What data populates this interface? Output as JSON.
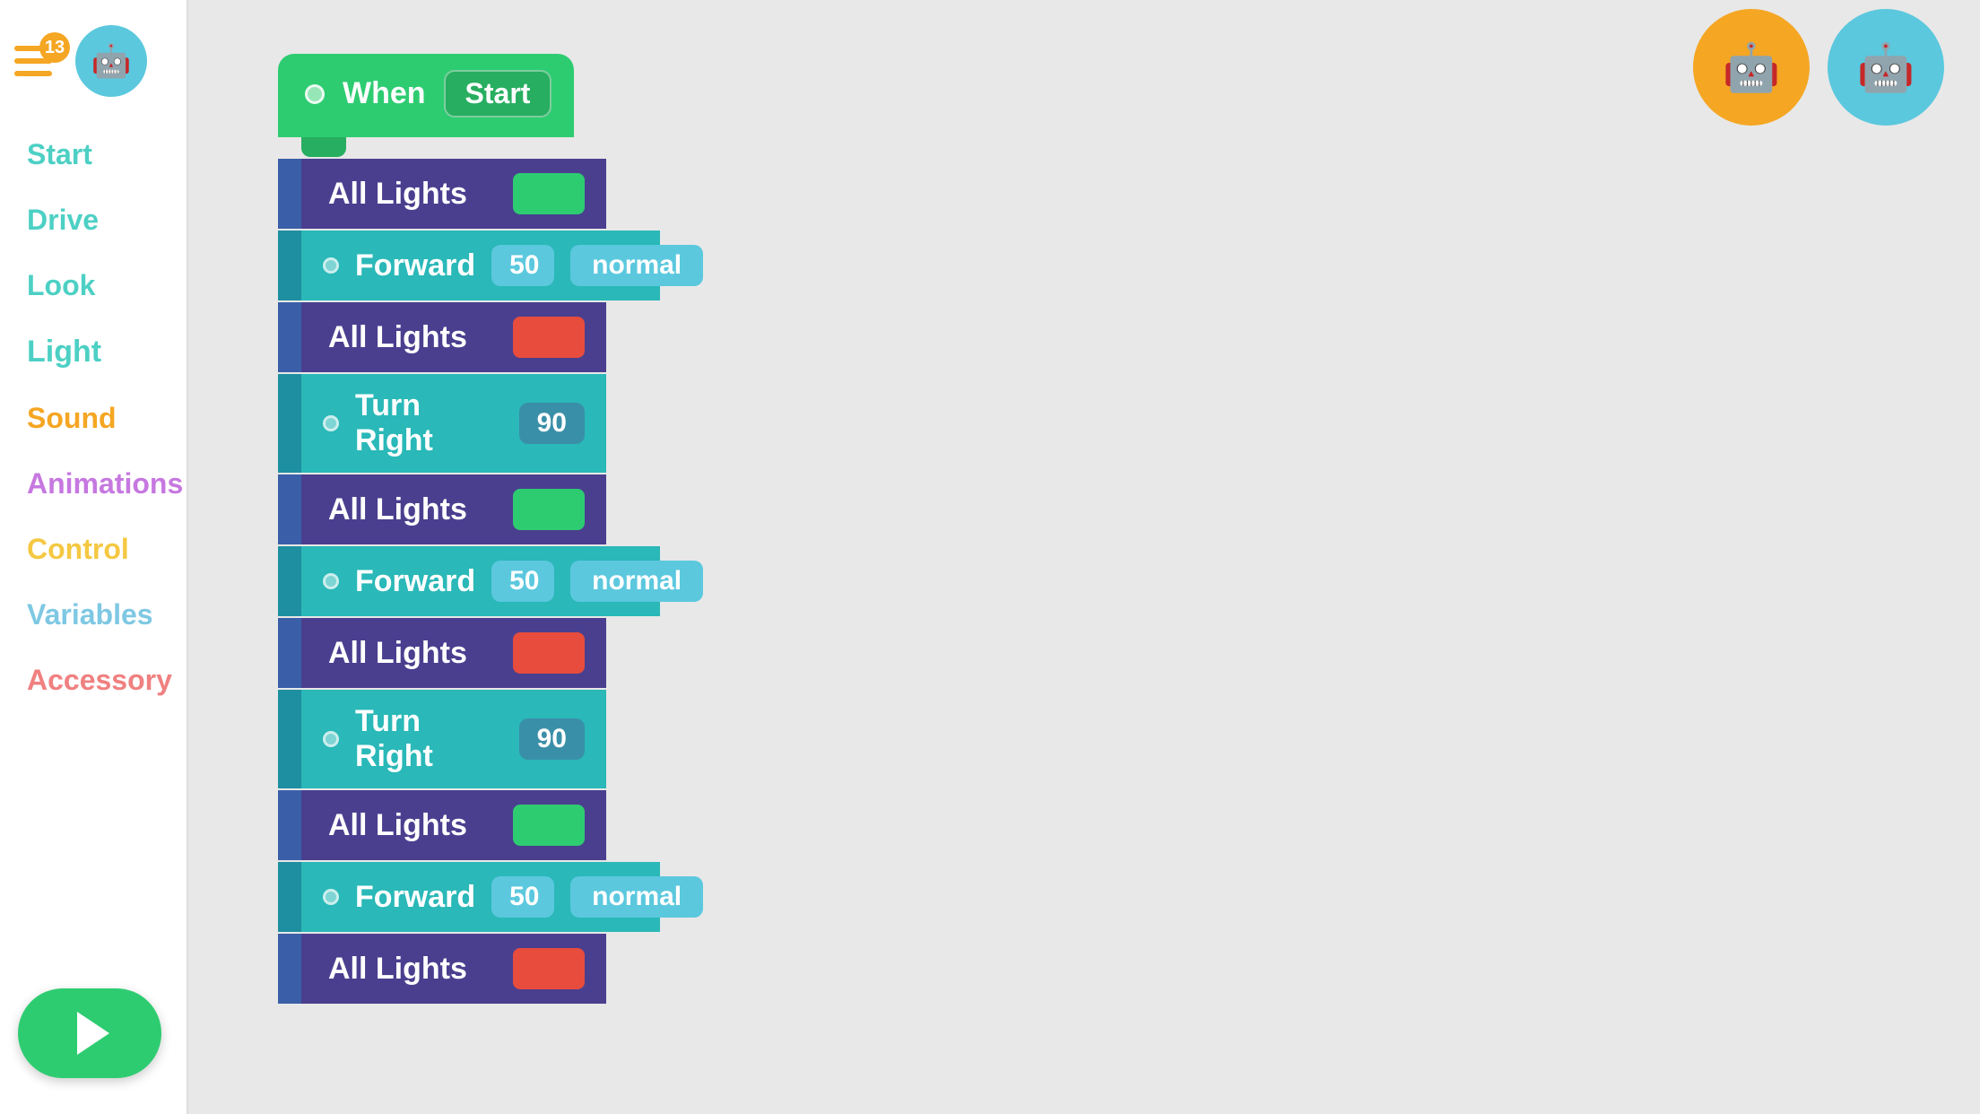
{
  "sidebar": {
    "badge": "13",
    "nav_items": [
      {
        "id": "start",
        "label": "Start",
        "color": "#4dd0c4"
      },
      {
        "id": "drive",
        "label": "Drive",
        "color": "#4dd0c4"
      },
      {
        "id": "look",
        "label": "Look",
        "color": "#4dd0c4"
      },
      {
        "id": "light",
        "label": "Light",
        "color": "#4dd0c4"
      },
      {
        "id": "sound",
        "label": "Sound",
        "color": "#f5a623"
      },
      {
        "id": "animations",
        "label": "Animations",
        "color": "#c678e0"
      },
      {
        "id": "control",
        "label": "Control",
        "color": "#f5c842"
      },
      {
        "id": "variables",
        "label": "Variables",
        "color": "#7ec8e3"
      },
      {
        "id": "accessory",
        "label": "Accessory",
        "color": "#f08080"
      }
    ]
  },
  "blocks": [
    {
      "type": "when_start",
      "label": "When",
      "start_label": "Start"
    },
    {
      "type": "all_lights",
      "label": "All Lights",
      "color": "green"
    },
    {
      "type": "forward",
      "label": "Forward",
      "value": "50",
      "mode": "normal"
    },
    {
      "type": "all_lights",
      "label": "All Lights",
      "color": "red"
    },
    {
      "type": "turn_right",
      "label": "Turn Right",
      "value": "90"
    },
    {
      "type": "all_lights",
      "label": "All Lights",
      "color": "green"
    },
    {
      "type": "forward",
      "label": "Forward",
      "value": "50",
      "mode": "normal"
    },
    {
      "type": "all_lights",
      "label": "All Lights",
      "color": "red"
    },
    {
      "type": "turn_right",
      "label": "Turn Right",
      "value": "90"
    },
    {
      "type": "all_lights",
      "label": "All Lights",
      "color": "green"
    },
    {
      "type": "forward",
      "label": "Forward",
      "value": "50",
      "mode": "normal"
    },
    {
      "type": "all_lights",
      "label": "All Lights",
      "color": "red"
    }
  ],
  "play_button": {
    "label": "▶"
  },
  "avatars": [
    {
      "id": "avatar1",
      "emoji": "🤖",
      "bg": "#f5a623"
    },
    {
      "id": "avatar2",
      "emoji": "🤖",
      "bg": "#5bc8de"
    }
  ]
}
